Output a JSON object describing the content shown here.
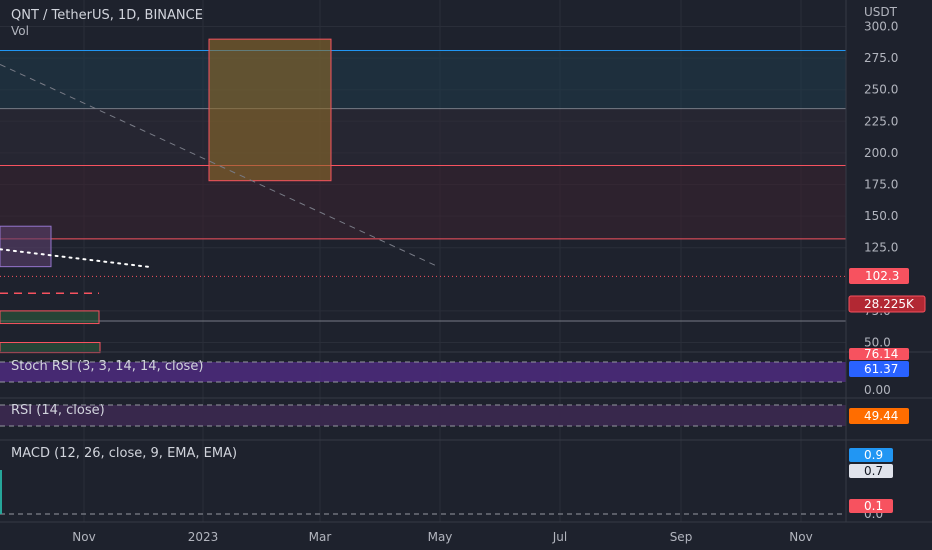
{
  "symbol_title": "QNT / TetherUS, 1D, BINANCE",
  "volume_label": "Vol",
  "colors": {
    "background": "#1e222d",
    "grid": "#2a2e39",
    "text": "#b2b5be",
    "price_badge": "#f7525f",
    "volume_badge": "#b22833",
    "stoch_k_badge": "#2962ff",
    "stoch_d_badge": "#f7525f",
    "stoch_band": "#7e57c2",
    "rsi_band": "#7e57c2",
    "rsi_badge": "#ff6d00",
    "macd_badge": "#2196f3",
    "signal_badge": "#ffffff",
    "hist_badge": "#f7525f"
  },
  "chart_data": [
    {
      "type": "line",
      "pane": "price",
      "currency": "USDT",
      "y_ticks": [
        "300.0",
        "275.0",
        "250.0",
        "225.0",
        "200.0",
        "175.0",
        "150.0",
        "125.0",
        "75.0",
        "50.0"
      ],
      "ylim": [
        42,
        300
      ],
      "x_ticks": [
        "Nov",
        "2023",
        "Mar",
        "May",
        "Jul",
        "Sep",
        "Nov"
      ],
      "last_price": "102.3",
      "last_volume": "28.225K",
      "horizontal_levels": [
        {
          "price": 281,
          "color": "#2196f3"
        },
        {
          "price": 235,
          "color": "#787b86"
        },
        {
          "price": 190,
          "color": "#f7525f"
        },
        {
          "price": 132,
          "color": "#f7525f"
        },
        {
          "price": 102.3,
          "color": "#f7525f",
          "style": "dotted"
        },
        {
          "price": 67,
          "color": "#787b86"
        }
      ],
      "rectangles": [
        {
          "x0": "2023-04-25",
          "x1": "2023-08-25",
          "top": 290,
          "bottom": 178,
          "fill": "#8d6a2a",
          "stroke": "#f7525f"
        },
        {
          "x0": "2022-09-28",
          "x1": "2022-11-18",
          "top": 142,
          "bottom": 110,
          "fill": "#5a3f6b",
          "stroke": "#9575cd"
        },
        {
          "x0": "2022-09-28",
          "x1": "2023-01-05",
          "top": 75,
          "bottom": 65,
          "fill": "#2c5c3c",
          "stroke": "#f7525f"
        },
        {
          "x0": "2022-09-28",
          "x1": "2023-01-06",
          "top": 50,
          "bottom": 42,
          "fill": "#2c5c3c",
          "stroke": "#f7525f"
        }
      ],
      "dashed_line_red": {
        "price": 89,
        "x0": "2022-09-28",
        "x1": "2023-01-05"
      },
      "dotted_trend": [
        {
          "x": "2022-09-28",
          "price": 123.8
        },
        {
          "x": "2023-02-26",
          "price": 109.6
        }
      ],
      "dashed_trend": [
        {
          "x": "2022-09-28",
          "price": 270
        },
        {
          "x": "2023-12-10",
          "price": 110
        }
      ]
    },
    {
      "type": "line",
      "pane": "stoch_rsi",
      "title": "Stoch RSI (3, 3, 14, 14, close)",
      "y_ticks": [
        "0.00"
      ],
      "last_k": "61.37",
      "last_d": "76.14"
    },
    {
      "type": "line",
      "pane": "rsi",
      "title": "RSI (14, close)",
      "last_value": "49.44"
    },
    {
      "type": "bar",
      "pane": "macd",
      "title": "MACD (12, 26, close, 9, EMA, EMA)",
      "y_ticks": [
        "0.0"
      ],
      "last_macd": "0.9",
      "last_signal": "0.7",
      "last_hist": "0.1"
    }
  ]
}
